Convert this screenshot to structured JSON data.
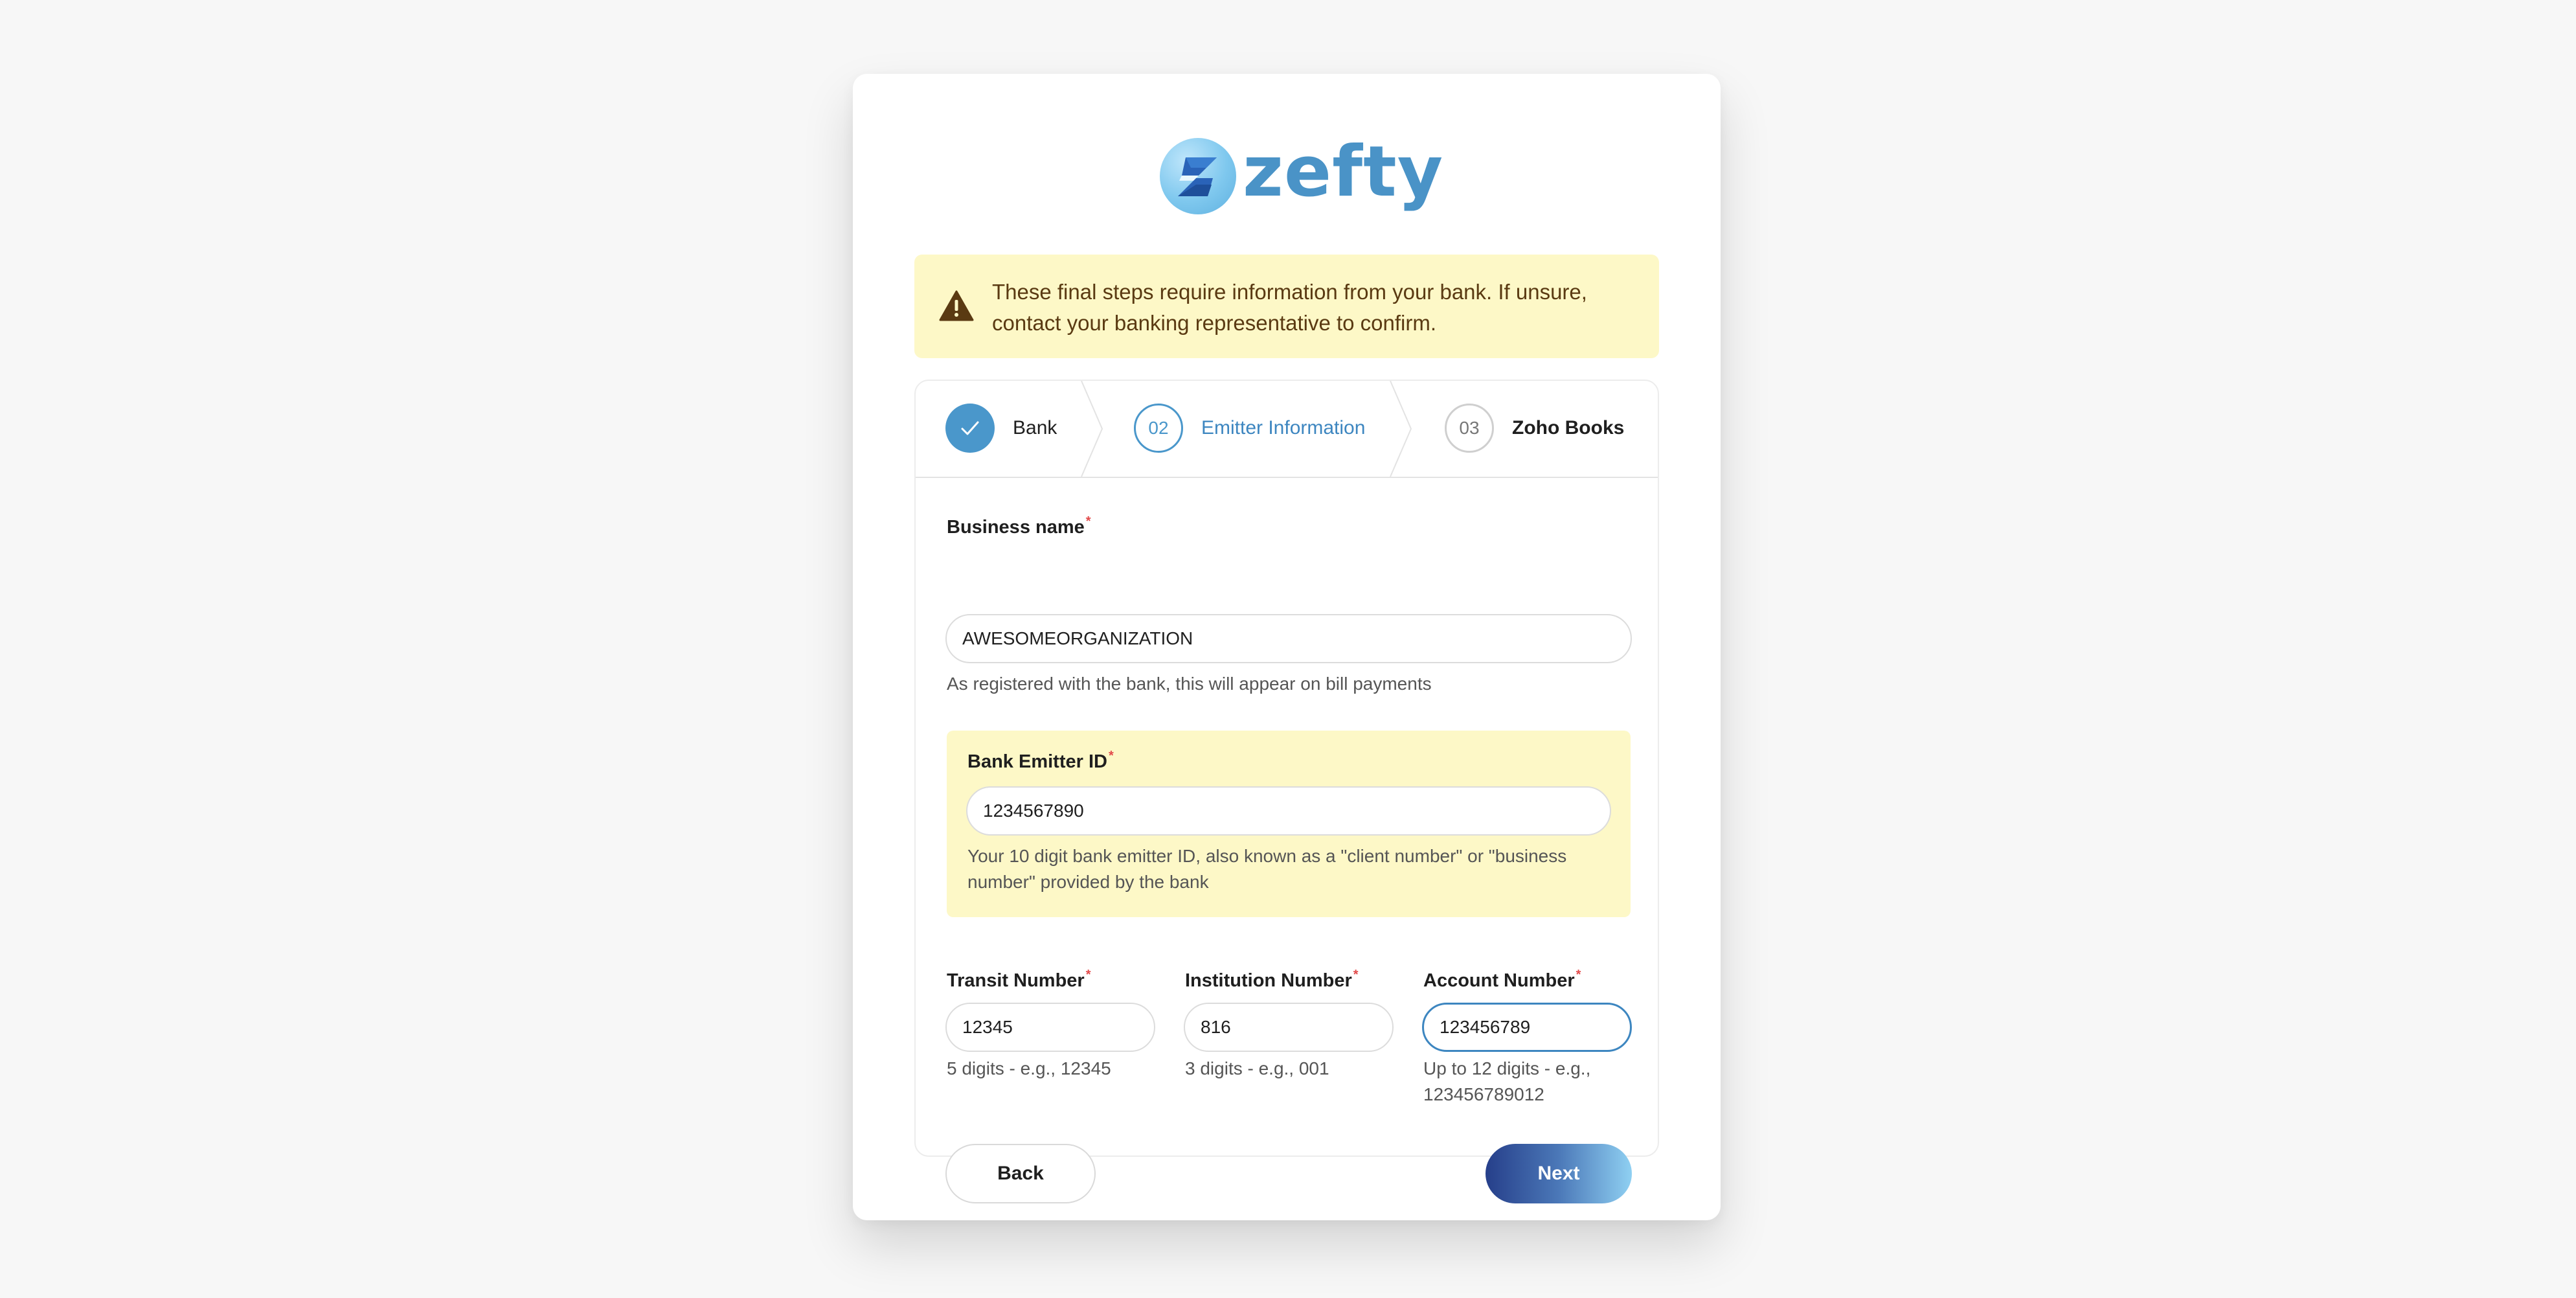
{
  "brand": {
    "name": "zefty",
    "color": "#4a93c7"
  },
  "notice": {
    "icon": "warning-icon",
    "text": "These final steps require information from your bank. If unsure, contact your banking representative to confirm."
  },
  "steps": [
    {
      "label": "Bank",
      "status": "completed",
      "icon": "check-icon"
    },
    {
      "number": "02",
      "label": "Emitter Information",
      "status": "active"
    },
    {
      "number": "03",
      "label": "Zoho Books",
      "status": "pending"
    }
  ],
  "form": {
    "business_name": {
      "label": "Business name",
      "required_mark": "*",
      "value": "AWESOMEORGANIZATION",
      "hint": "As registered with the bank, this will appear on bill payments"
    },
    "emitter_id": {
      "label": "Bank Emitter ID",
      "required_mark": "*",
      "value": "1234567890",
      "hint_line1": "Your 10 digit bank emitter ID, also known as a \"client number\" or \"business",
      "hint_line2": "number\" provided by the bank"
    },
    "transit": {
      "label": "Transit Number",
      "required_mark": "*",
      "value": "12345",
      "hint": "5 digits - e.g., 12345"
    },
    "institution": {
      "label": "Institution Number",
      "required_mark": "*",
      "value": "816",
      "hint": "3 digits - e.g., 001"
    },
    "account": {
      "label": "Account Number",
      "required_mark": "*",
      "value": "123456789",
      "hint_line1": "Up to 12 digits - e.g.,",
      "hint_line2": "123456789012"
    }
  },
  "buttons": {
    "back": "Back",
    "next": "Next"
  },
  "colors": {
    "accent": "#4a97cb",
    "notice_bg": "#fdf8c7",
    "notice_text": "#5a3a12",
    "required": "#e24a4a"
  }
}
